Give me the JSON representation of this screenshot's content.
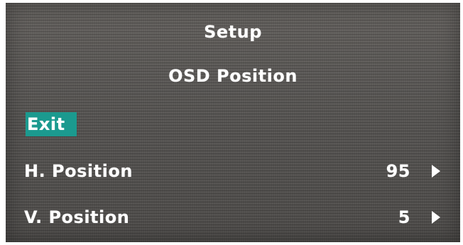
{
  "menu": {
    "title": "Setup",
    "subtitle": "OSD Position",
    "exit_label": "Exit",
    "items": [
      {
        "label": "H. Position",
        "value": "95",
        "icon": "right-triangle-icon"
      },
      {
        "label": "V. Position",
        "value": "5",
        "icon": "right-triangle-icon"
      }
    ]
  },
  "colors": {
    "background": "#595755",
    "text": "#ffffff",
    "highlight": "#1b9a8f"
  }
}
